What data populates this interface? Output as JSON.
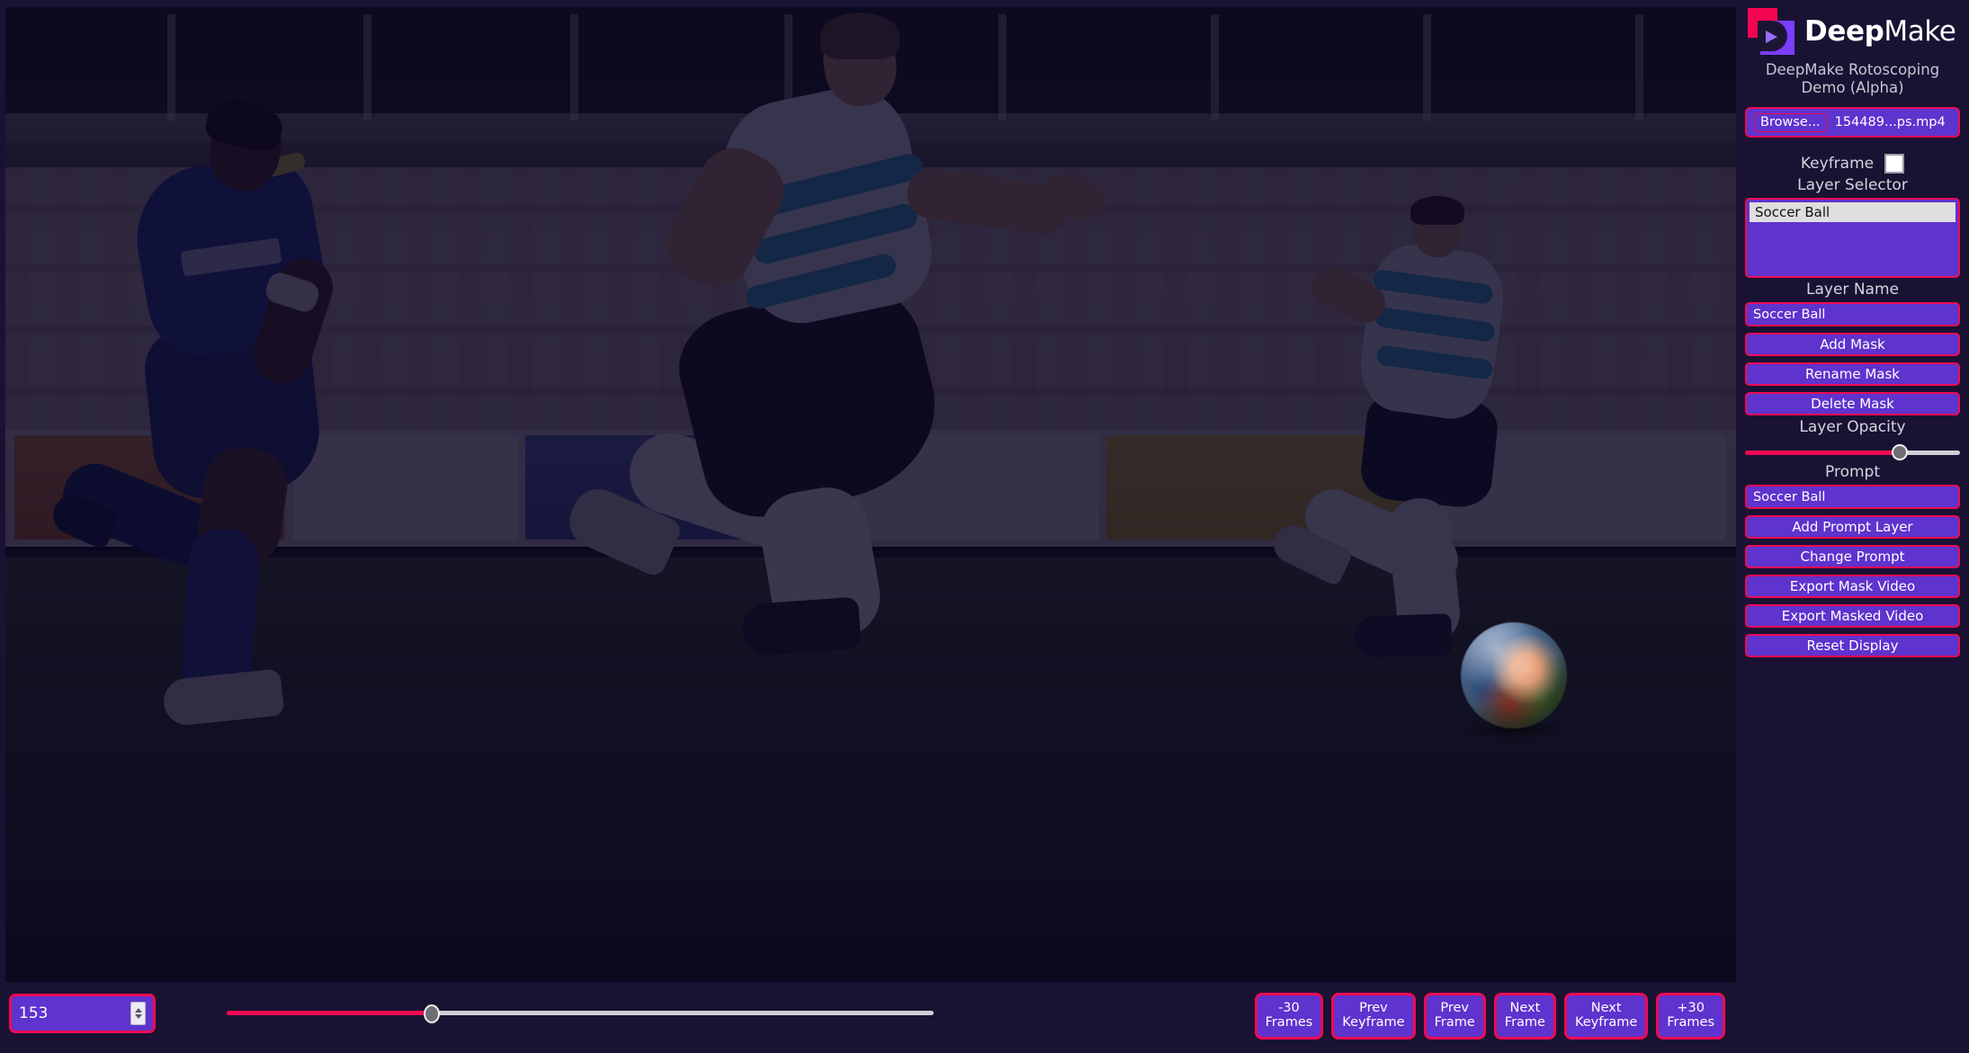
{
  "brand": {
    "name_bold": "Deep",
    "name_thin": "Make",
    "logo_icon": "deepmake-play-logo-icon",
    "subtitle": "DeepMake Rotoscoping Demo (Alpha)"
  },
  "colors": {
    "accent_pink": "#ED0B53",
    "accent_purple": "#5E33CE",
    "background": "#191233",
    "text": "#FFFFFF",
    "muted_text": "#D6D3DE"
  },
  "file_picker": {
    "browse_label": "Browse...",
    "file_name": "154489...ps.mp4"
  },
  "keyframe": {
    "label": "Keyframe",
    "checked": false
  },
  "layer_selector": {
    "label": "Layer Selector",
    "items": [
      {
        "label": "Soccer Ball",
        "selected": true
      }
    ]
  },
  "layer_name": {
    "label": "Layer Name",
    "value": "Soccer Ball"
  },
  "mask_buttons": [
    {
      "label": "Add Mask",
      "name": "add-mask-button"
    },
    {
      "label": "Rename Mask",
      "name": "rename-mask-button"
    },
    {
      "label": "Delete Mask",
      "name": "delete-mask-button"
    }
  ],
  "layer_opacity": {
    "label": "Layer Opacity",
    "value_percent": 72
  },
  "prompt": {
    "label": "Prompt",
    "value": "Soccer Ball"
  },
  "prompt_buttons": [
    {
      "label": "Add Prompt Layer",
      "name": "add-prompt-layer-button"
    },
    {
      "label": "Change Prompt",
      "name": "change-prompt-button"
    },
    {
      "label": "Export Mask Video",
      "name": "export-mask-video-button"
    },
    {
      "label": "Export Masked Video",
      "name": "export-masked-video-button"
    },
    {
      "label": "Reset Display",
      "name": "reset-display-button"
    }
  ],
  "timeline": {
    "frame_value": "153",
    "position_percent": 29
  },
  "nav_buttons": [
    {
      "label": "-30\nFrames",
      "name": "minus-30-frames-button"
    },
    {
      "label": "Prev\nKeyframe",
      "name": "prev-keyframe-button"
    },
    {
      "label": "Prev\nFrame",
      "name": "prev-frame-button"
    },
    {
      "label": "Next\nFrame",
      "name": "next-frame-button"
    },
    {
      "label": "Next\nKeyframe",
      "name": "next-keyframe-button"
    },
    {
      "label": "+30\nFrames",
      "name": "plus-30-frames-button"
    }
  ],
  "viewport": {
    "description": "Soccer match video frame: three players on a pitch, a masked soccer ball highlighted at right"
  }
}
